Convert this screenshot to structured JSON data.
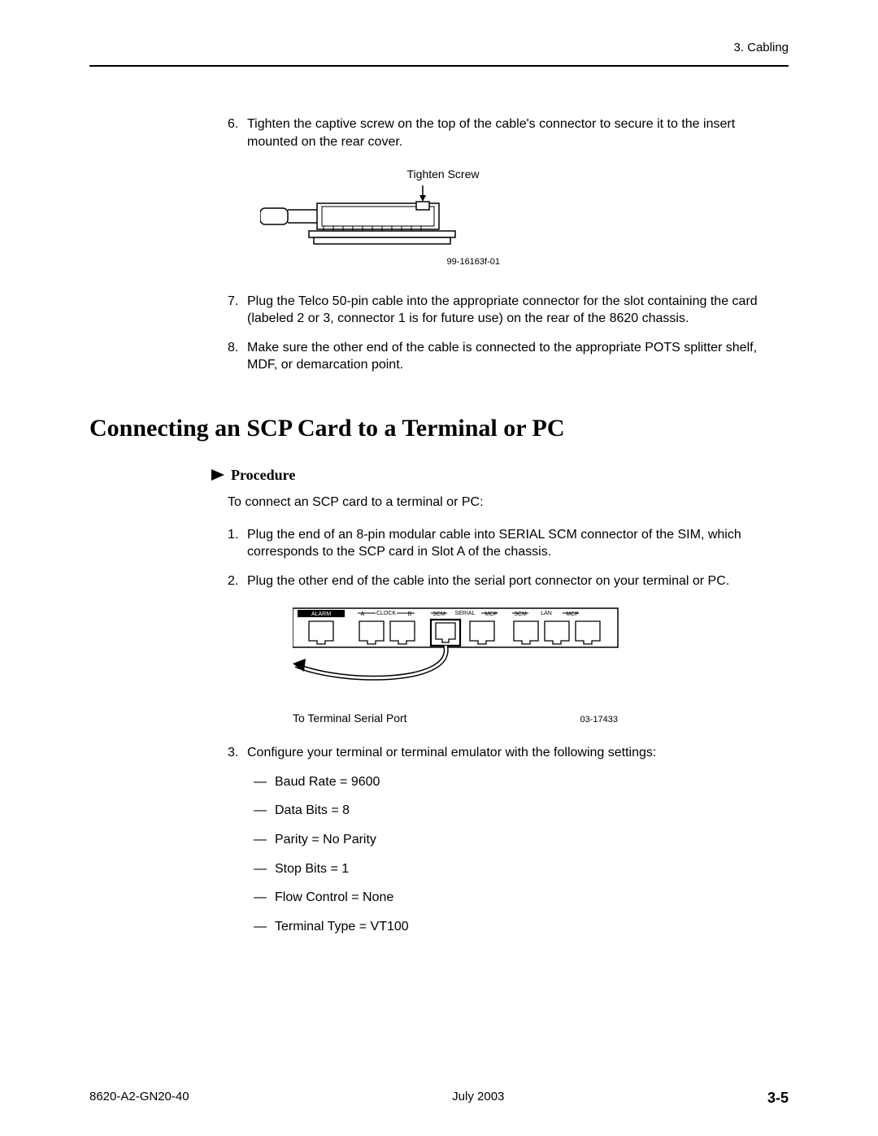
{
  "header": {
    "chapter": "3. Cabling"
  },
  "steps_a": [
    {
      "n": "6.",
      "t": "Tighten the captive screw on the top of the cable's connector to secure it to the insert mounted on the rear cover."
    },
    {
      "n": "7.",
      "t": "Plug the Telco 50-pin cable into the appropriate connector for the slot containing the card (labeled 2 or 3, connector 1 is for future use) on the rear of the 8620 chassis."
    },
    {
      "n": "8.",
      "t": "Make sure the other end of the cable is connected to the appropriate POTS splitter shelf, MDF, or demarcation point."
    }
  ],
  "fig1": {
    "top_label": "Tighten Screw",
    "id": "99-16163f-01"
  },
  "section_title": "Connecting an SCP Card to a Terminal or PC",
  "procedure_label": "Procedure",
  "intro": "To connect an SCP card to a terminal or PC:",
  "steps_b": [
    {
      "n": "1.",
      "t": "Plug the end of an 8-pin modular cable into SERIAL SCM connector of the SIM, which corresponds to the SCP card in Slot A of the chassis."
    },
    {
      "n": "2.",
      "t": "Plug the other end of the cable into the serial port connector on your terminal or PC."
    },
    {
      "n": "3.",
      "t": "Configure your terminal or terminal emulator with the following settings:"
    }
  ],
  "fig2": {
    "labels": {
      "alarm": "ALARM",
      "a": "A",
      "clock": "CLOCK",
      "b": "B",
      "scm1": "SCM",
      "serial": "SERIAL",
      "mcp1": "MCP",
      "scm2": "SCM",
      "lan": "LAN",
      "mcp2": "MCP"
    },
    "bottom_left": "To Terminal Serial Port",
    "id": "03-17433"
  },
  "settings": [
    "Baud Rate = 9600",
    "Data Bits = 8",
    "Parity = No Parity",
    "Stop Bits = 1",
    "Flow Control = None",
    "Terminal Type = VT100"
  ],
  "footer": {
    "doc": "8620-A2-GN20-40",
    "date": "July 2003",
    "page": "3-5"
  }
}
